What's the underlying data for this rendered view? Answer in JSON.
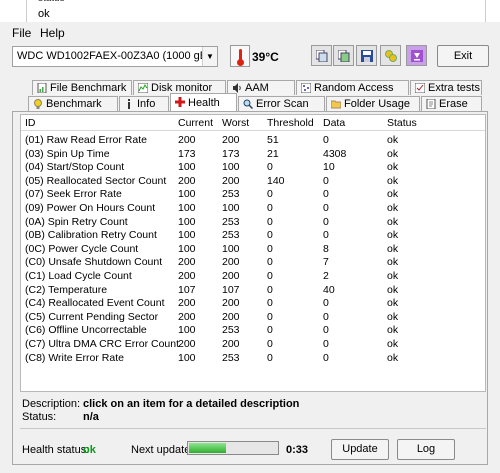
{
  "background": {
    "clipped_text": "status",
    "ok_text": "ok"
  },
  "menu": {
    "file": "File",
    "help": "Help"
  },
  "toolbar": {
    "drive": "WDC WD1002FAEX-00Z3A0 (1000 gB)",
    "temperature": "39°C",
    "exit": "Exit"
  },
  "tabs_row1": [
    {
      "label": "File Benchmark",
      "icon": "file-benchmark-icon"
    },
    {
      "label": "Disk monitor",
      "icon": "disk-monitor-icon"
    },
    {
      "label": "AAM",
      "icon": "speaker-icon"
    },
    {
      "label": "Random Access",
      "icon": "random-access-icon"
    },
    {
      "label": "Extra tests",
      "icon": "extra-tests-icon"
    }
  ],
  "tabs_row2": [
    {
      "label": "Benchmark",
      "icon": "bulb-icon"
    },
    {
      "label": "Info",
      "icon": "info-icon"
    },
    {
      "label": "Health",
      "icon": "health-cross-icon"
    },
    {
      "label": "Error Scan",
      "icon": "magnifier-icon"
    },
    {
      "label": "Folder Usage",
      "icon": "folder-icon"
    },
    {
      "label": "Erase",
      "icon": "erase-icon"
    }
  ],
  "table": {
    "headers": {
      "id": "ID",
      "current": "Current",
      "worst": "Worst",
      "threshold": "Threshold",
      "data": "Data",
      "status": "Status"
    },
    "rows": [
      {
        "id": "(01) Raw Read Error Rate",
        "current": "200",
        "worst": "200",
        "threshold": "51",
        "data": "0",
        "status": "ok"
      },
      {
        "id": "(03) Spin Up Time",
        "current": "173",
        "worst": "173",
        "threshold": "21",
        "data": "4308",
        "status": "ok"
      },
      {
        "id": "(04) Start/Stop Count",
        "current": "100",
        "worst": "100",
        "threshold": "0",
        "data": "10",
        "status": "ok"
      },
      {
        "id": "(05) Reallocated Sector Count",
        "current": "200",
        "worst": "200",
        "threshold": "140",
        "data": "0",
        "status": "ok"
      },
      {
        "id": "(07) Seek Error Rate",
        "current": "100",
        "worst": "253",
        "threshold": "0",
        "data": "0",
        "status": "ok"
      },
      {
        "id": "(09) Power On Hours Count",
        "current": "100",
        "worst": "100",
        "threshold": "0",
        "data": "0",
        "status": "ok"
      },
      {
        "id": "(0A) Spin Retry Count",
        "current": "100",
        "worst": "253",
        "threshold": "0",
        "data": "0",
        "status": "ok"
      },
      {
        "id": "(0B) Calibration Retry Count",
        "current": "100",
        "worst": "253",
        "threshold": "0",
        "data": "0",
        "status": "ok"
      },
      {
        "id": "(0C) Power Cycle Count",
        "current": "100",
        "worst": "100",
        "threshold": "0",
        "data": "8",
        "status": "ok"
      },
      {
        "id": "(C0) Unsafe Shutdown Count",
        "current": "200",
        "worst": "200",
        "threshold": "0",
        "data": "7",
        "status": "ok"
      },
      {
        "id": "(C1) Load Cycle Count",
        "current": "200",
        "worst": "200",
        "threshold": "0",
        "data": "2",
        "status": "ok"
      },
      {
        "id": "(C2) Temperature",
        "current": "107",
        "worst": "107",
        "threshold": "0",
        "data": "40",
        "status": "ok"
      },
      {
        "id": "(C4) Reallocated Event Count",
        "current": "200",
        "worst": "200",
        "threshold": "0",
        "data": "0",
        "status": "ok"
      },
      {
        "id": "(C5) Current Pending Sector",
        "current": "200",
        "worst": "200",
        "threshold": "0",
        "data": "0",
        "status": "ok"
      },
      {
        "id": "(C6) Offline Uncorrectable",
        "current": "100",
        "worst": "253",
        "threshold": "0",
        "data": "0",
        "status": "ok"
      },
      {
        "id": "(C7) Ultra DMA CRC Error Count",
        "current": "200",
        "worst": "200",
        "threshold": "0",
        "data": "0",
        "status": "ok"
      },
      {
        "id": "(C8) Write Error Rate",
        "current": "100",
        "worst": "253",
        "threshold": "0",
        "data": "0",
        "status": "ok"
      }
    ]
  },
  "details": {
    "description_label": "Description:",
    "description_value": "click on an item for a detailed description",
    "status_label": "Status:",
    "status_value": "n/a"
  },
  "footer": {
    "health_status_label": "Health status:",
    "health_status_value": "ok",
    "health_status_color": "#0a9a1a",
    "next_update_label": "Next update:",
    "progress_percent": 42,
    "timer": "0:33",
    "update_button": "Update",
    "log_button": "Log"
  }
}
